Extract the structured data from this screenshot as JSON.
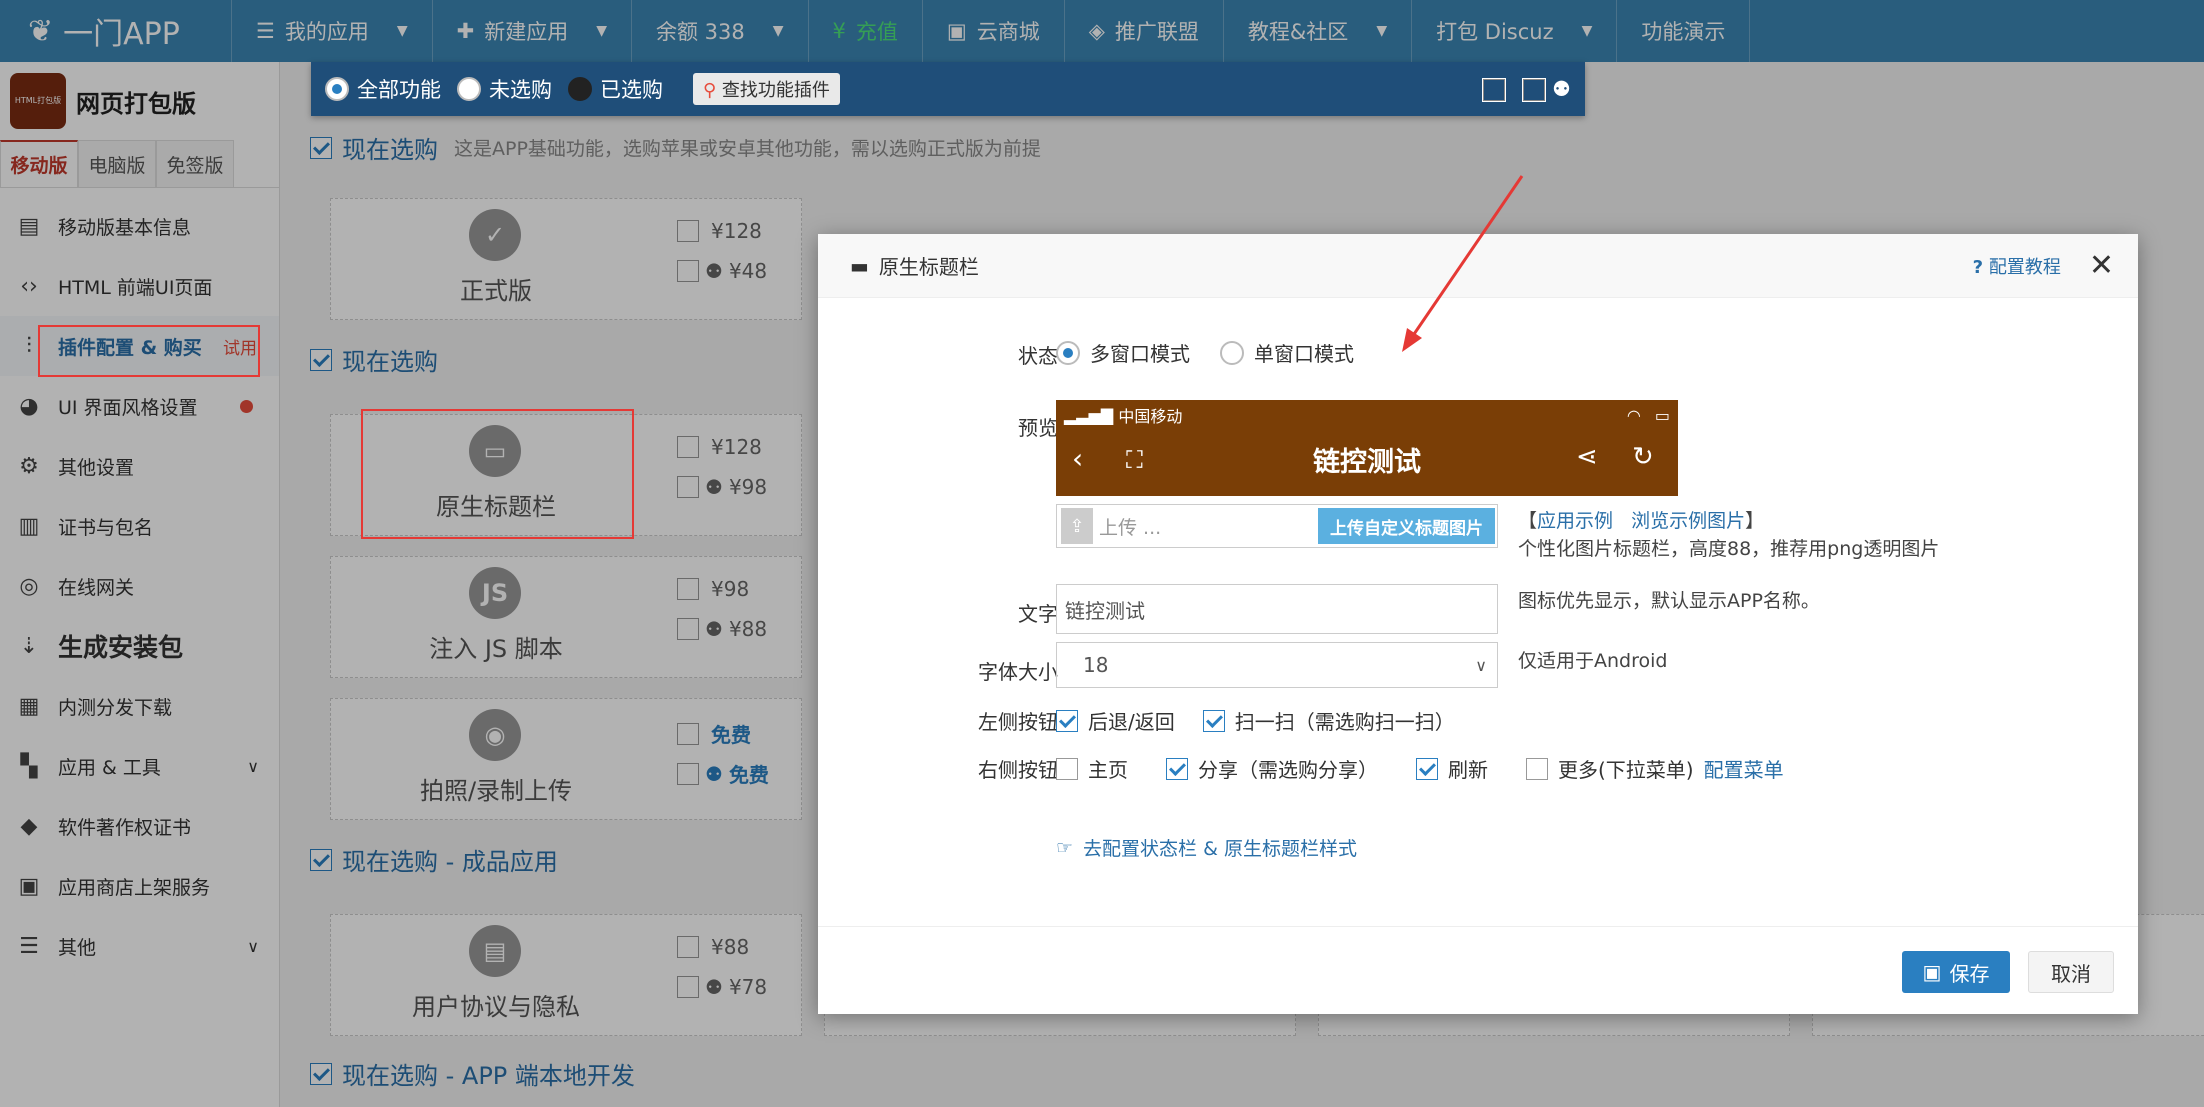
{
  "brand": {
    "name": "一门APP"
  },
  "topnav": [
    {
      "icon": "list-icon",
      "glyph": "☰",
      "label": "我的应用",
      "caret": true
    },
    {
      "icon": "plus-icon",
      "glyph": "✚",
      "label": "新建应用",
      "caret": true
    },
    {
      "icon": "",
      "glyph": "",
      "label": "余额 338",
      "caret": true
    },
    {
      "icon": "yen-icon",
      "glyph": "¥",
      "label": "充值",
      "caret": false,
      "green": true
    },
    {
      "icon": "cart-icon",
      "glyph": "▣",
      "label": "云商城",
      "caret": false
    },
    {
      "icon": "diamond-icon",
      "glyph": "◈",
      "label": "推广联盟",
      "caret": false
    },
    {
      "icon": "",
      "glyph": "",
      "label": "教程&社区",
      "caret": true
    },
    {
      "icon": "",
      "glyph": "",
      "label": "打包 Discuz",
      "caret": true
    },
    {
      "icon": "",
      "glyph": "",
      "label": "功能演示",
      "caret": false
    }
  ],
  "sidebar": {
    "logo_text": "HTML打包版",
    "title": "网页打包版",
    "tabs": [
      "移动版",
      "电脑版",
      "免签版"
    ],
    "items": [
      {
        "label": "移动版基本信息",
        "icon": "document-icon",
        "glyph": "▤"
      },
      {
        "label": "HTML 前端UI页面",
        "icon": "code-icon",
        "glyph": "‹›"
      },
      {
        "label": "插件配置 & 购买",
        "icon": "sliders-icon",
        "glyph": "⫶",
        "badge": "试用"
      },
      {
        "label": "UI 界面风格设置",
        "icon": "palette-icon",
        "glyph": "◕"
      },
      {
        "label": "其他设置",
        "icon": "gear-icon",
        "glyph": "⚙"
      },
      {
        "label": "证书与包名",
        "icon": "certificate-icon",
        "glyph": "▥"
      },
      {
        "label": "在线网关",
        "icon": "gateway-icon",
        "glyph": "◎"
      },
      {
        "label": "生成安装包",
        "icon": "sort-download-icon",
        "glyph": "⇣"
      },
      {
        "label": "内测分发下载",
        "icon": "qrcode-icon",
        "glyph": "▦"
      },
      {
        "label": "应用 & 工具",
        "icon": "apps-icon",
        "glyph": "▚"
      },
      {
        "label": "软件著作权证书",
        "icon": "copyright-icon",
        "glyph": "◆"
      },
      {
        "label": "应用商店上架服务",
        "icon": "store-icon",
        "glyph": "▣"
      },
      {
        "label": "其他",
        "icon": "menu-icon",
        "glyph": "☰"
      }
    ]
  },
  "filterbar": {
    "options": [
      "全部功能",
      "未选购",
      "已选购"
    ],
    "search_label": "查找功能插件"
  },
  "sections": [
    {
      "title": "现在选购",
      "note": "这是APP基础功能，选购苹果或安卓其他功能，需以选购正式版为前提"
    },
    {
      "title": "现在选购",
      "note": ""
    },
    {
      "title": "现在选购 - 成品应用",
      "note": ""
    },
    {
      "title": "现在选购 - APP 端本地开发",
      "note": ""
    }
  ],
  "cards": [
    {
      "name": "正式版",
      "icon": "shield-check-icon",
      "glyph": "✓",
      "ios": "¥128",
      "android": "¥48"
    },
    {
      "name": "原生标题栏",
      "icon": "titlebar-icon",
      "glyph": "▭",
      "ios": "¥128",
      "android": "¥98"
    },
    {
      "name": "注入 JS 脚本",
      "icon": "js-icon",
      "glyph": "JS",
      "ios": "¥98",
      "android": "¥88"
    },
    {
      "name": "拍照/录制上传",
      "icon": "camera-icon",
      "glyph": "◉",
      "ios": "免费",
      "android": "免费"
    },
    {
      "name": "用户协议与隐私",
      "icon": "agreement-icon",
      "glyph": "▤",
      "ios": "¥88",
      "android": "¥78"
    }
  ],
  "modal": {
    "title": "原生标题栏",
    "help": "配置教程",
    "status_label": "状态",
    "status_options": [
      "多窗口模式",
      "单窗口模式"
    ],
    "preview_label": "预览",
    "preview": {
      "carrier": "中国移动",
      "title": "链控测试"
    },
    "upload_placeholder": "上传 ...",
    "upload_button": "上传自定义标题图片",
    "upload_links_open": "【",
    "upload_link1": "应用示例",
    "upload_link2": "浏览示例图片",
    "upload_links_close": "】",
    "upload_hint": "个性化图片标题栏，高度88，推荐用png透明图片",
    "text_label": "文字",
    "text_value": "链控测试",
    "text_hint": "图标优先显示，默认显示APP名称。",
    "font_label": "字体大小",
    "font_value": "18",
    "font_hint": "仅适用于Android",
    "left_label": "左侧按钮",
    "left_options": [
      {
        "label": "后退/返回",
        "checked": true
      },
      {
        "label": "扫一扫（需选购扫一扫）",
        "checked": true
      }
    ],
    "right_label": "右侧按钮",
    "right_options": [
      {
        "label": "主页",
        "checked": false
      },
      {
        "label": "分享（需选购分享）",
        "checked": true
      },
      {
        "label": "刷新",
        "checked": true
      },
      {
        "label": "更多(下拉菜单)",
        "checked": false
      }
    ],
    "menu_link": "配置菜单",
    "style_link": "去配置状态栏 & 原生标题栏样式",
    "save": "保存",
    "cancel": "取消"
  },
  "colors": {
    "nav": "#3b86b3",
    "filterbar": "#1f4e79",
    "preview": "#7a3e06",
    "accent": "#2a7fc1",
    "alert": "#e53935"
  }
}
